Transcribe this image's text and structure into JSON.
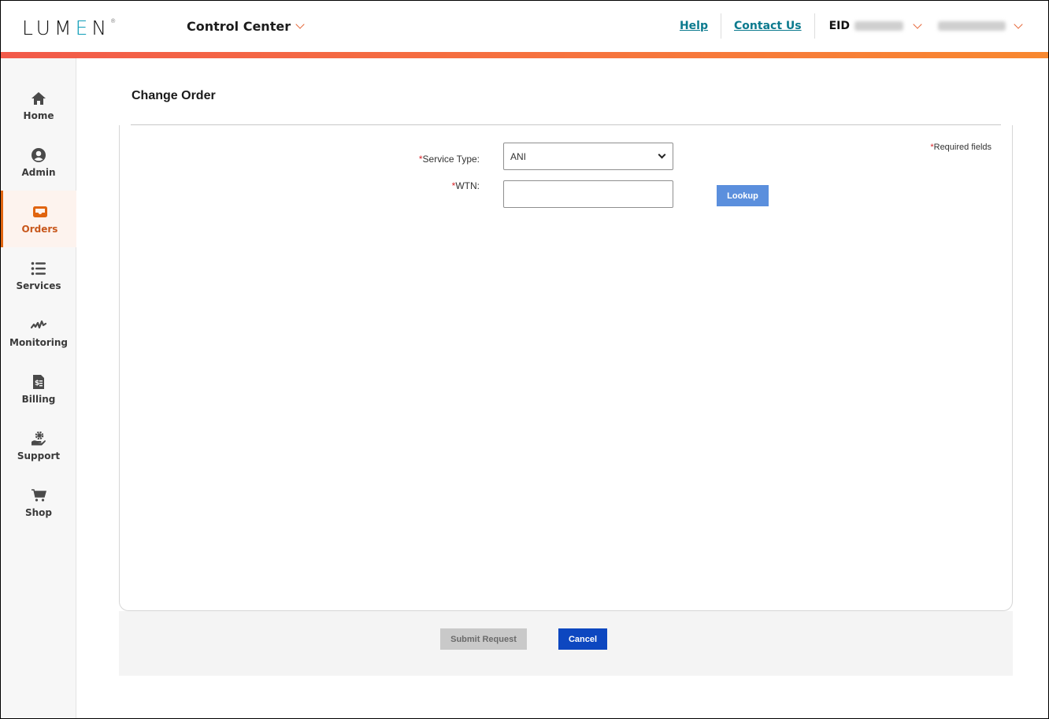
{
  "header": {
    "logo_text_1": "LUM",
    "logo_text_2": "E",
    "logo_text_3": "N",
    "logo_mark": "®",
    "app_switcher_label": "Control Center",
    "links": [
      {
        "label": "Help"
      },
      {
        "label": "Contact Us"
      }
    ],
    "eid_label": "EID",
    "eid_value_redacted": true,
    "account_value_redacted": true
  },
  "sidebar": {
    "items": [
      {
        "label": "Home",
        "icon": "home-icon",
        "active": false
      },
      {
        "label": "Admin",
        "icon": "user-circle-icon",
        "active": false
      },
      {
        "label": "Orders",
        "icon": "inbox-icon",
        "active": true
      },
      {
        "label": "Services",
        "icon": "list-icon",
        "active": false
      },
      {
        "label": "Monitoring",
        "icon": "pulse-icon",
        "active": false
      },
      {
        "label": "Billing",
        "icon": "invoice-icon",
        "active": false
      },
      {
        "label": "Support",
        "icon": "support-hand-gear-icon",
        "active": false
      },
      {
        "label": "Shop",
        "icon": "cart-icon",
        "active": false
      }
    ]
  },
  "main": {
    "page_title": "Change Order",
    "required_note": "Required fields",
    "required_marker": "*",
    "form": {
      "service_type": {
        "label": "Service Type:",
        "value": "ANI"
      },
      "wtn": {
        "label": "WTN:",
        "value": "",
        "placeholder": ""
      },
      "lookup_label": "Lookup"
    },
    "footer": {
      "submit_label": "Submit Request",
      "cancel_label": "Cancel"
    }
  },
  "colors": {
    "brand_orange": "#e0640f",
    "link_teal": "#0b7a8e",
    "lookup_blue": "#5b8fdd",
    "cancel_blue": "#0d47c0",
    "required_red": "#d9252a"
  }
}
